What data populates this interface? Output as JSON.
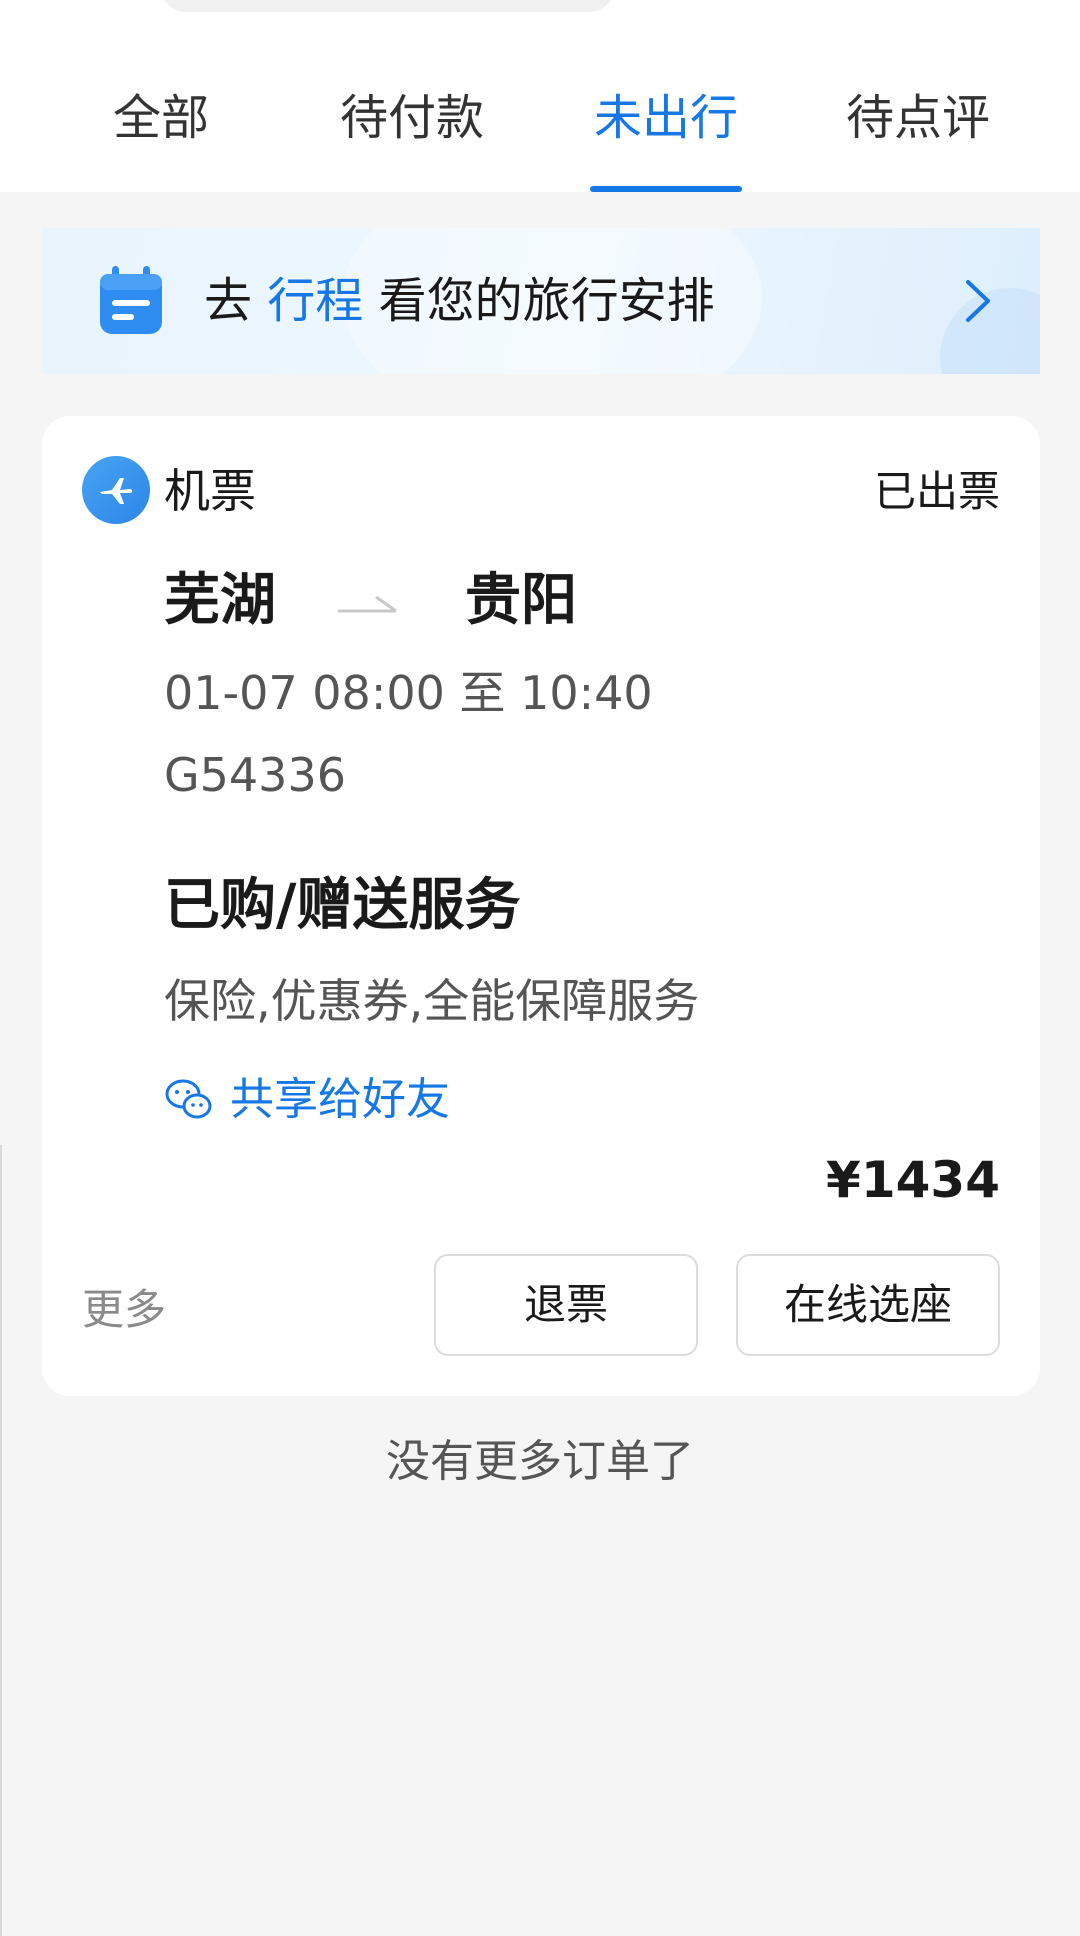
{
  "tabs": [
    {
      "label": "全部",
      "active": false
    },
    {
      "label": "待付款",
      "active": false
    },
    {
      "label": "未出行",
      "active": true
    },
    {
      "label": "待点评",
      "active": false
    }
  ],
  "banner": {
    "prefix": "去",
    "highlight": "行程",
    "suffix": "看您的旅行安排",
    "icon": "calendar-icon",
    "arrow_icon": "chevron-right-icon"
  },
  "order": {
    "type_label": "机票",
    "type_icon": "airplane-icon",
    "status": "已出票",
    "from_city": "芜湖",
    "to_city": "贵阳",
    "time": "01-07 08:00 至 10:40",
    "flight_no": "G54336",
    "services_title": "已购/赠送服务",
    "services": "保险,优惠券,全能保障服务",
    "share_label": "共享给好友",
    "share_icon": "wechat-icon",
    "price": "¥1434",
    "more_label": "更多",
    "refund_label": "退票",
    "seat_label": "在线选座"
  },
  "footer": {
    "no_more": "没有更多订单了"
  },
  "colors": {
    "accent": "#1677e6",
    "background": "#f5f5f5",
    "card": "#ffffff"
  }
}
